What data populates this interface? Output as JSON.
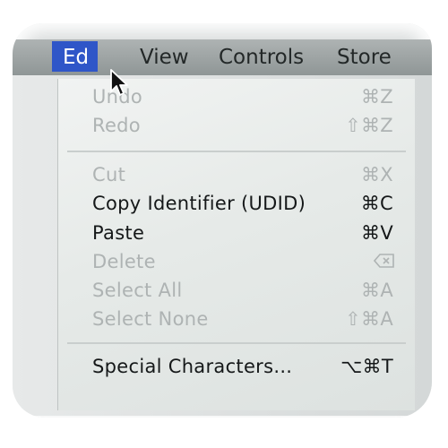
{
  "menubar": {
    "items": [
      {
        "label": "Ed",
        "active": true
      },
      {
        "label": "View",
        "active": false
      },
      {
        "label": "Controls",
        "active": false
      },
      {
        "label": "Store",
        "active": false
      }
    ]
  },
  "edit_menu": {
    "items": [
      {
        "label": "Undo",
        "shortcut": "⌘Z",
        "enabled": false
      },
      {
        "label": "Redo",
        "shortcut": "⇧⌘Z",
        "enabled": false
      },
      {
        "label": "Cut",
        "shortcut": "⌘X",
        "enabled": false
      },
      {
        "label": "Copy Identifier (UDID)",
        "shortcut": "⌘C",
        "enabled": true
      },
      {
        "label": "Paste",
        "shortcut": "⌘V",
        "enabled": true
      },
      {
        "label": "Delete",
        "shortcut": "",
        "shortcut_icon": "delete-key-icon",
        "enabled": false
      },
      {
        "label": "Select All",
        "shortcut": "⌘A",
        "enabled": false
      },
      {
        "label": "Select None",
        "shortcut": "⇧⌘A",
        "enabled": false
      },
      {
        "label": "Special Characters...",
        "shortcut": "⌥⌘T",
        "enabled": true
      }
    ]
  },
  "colors": {
    "highlight": "#2f56c8",
    "disabled_text": "#aeb3b3",
    "enabled_text": "#151819"
  }
}
